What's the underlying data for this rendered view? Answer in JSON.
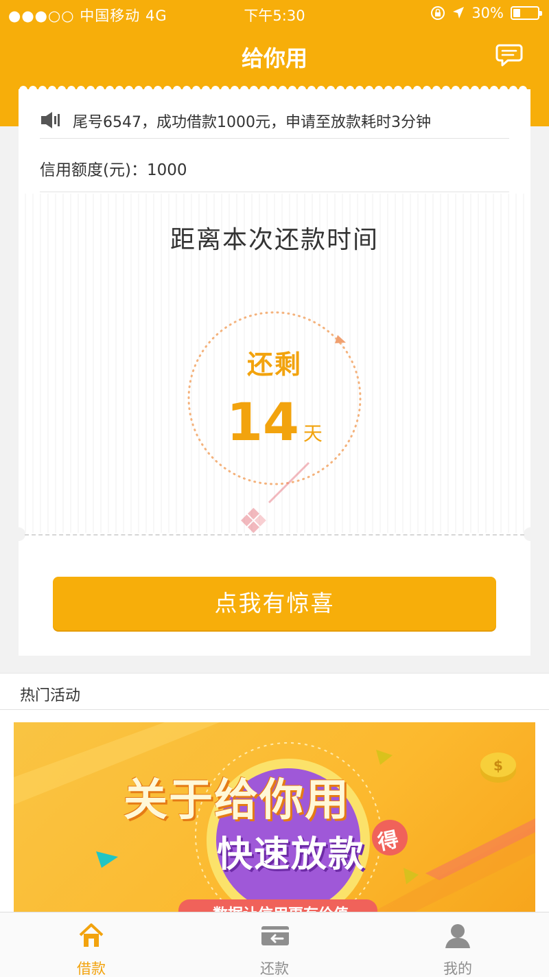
{
  "status_bar": {
    "carrier": "●●●○○ 中国移动   4G",
    "time": "下午5:30",
    "battery": "30%",
    "battery_level": 0.3
  },
  "header": {
    "title": "给你用",
    "message_icon": "chat-bubble-icon"
  },
  "notice": {
    "icon": "speaker-icon",
    "text": "尾号6547，成功借款1000元，申请至放款耗时3分钟"
  },
  "credit": {
    "label": "信用额度(元)：1000"
  },
  "countdown": {
    "title": "距离本次还款时间",
    "remain_label": "还剩",
    "days": "14",
    "unit": "天"
  },
  "cta": {
    "label": "点我有惊喜"
  },
  "activities": {
    "title": "热门活动",
    "banner": {
      "line1": "关于给你用",
      "line2": "快速放款",
      "badge": "得",
      "bottom_text": "数据让信用更有价值"
    }
  },
  "colors": {
    "brand": "#f7ae0a",
    "accent_text": "#f2a30e",
    "tab_inactive": "#8e8e8e"
  },
  "tabs": [
    {
      "label": "借款",
      "icon": "home-icon",
      "active": true
    },
    {
      "label": "还款",
      "icon": "wallet-icon",
      "active": false
    },
    {
      "label": "我的",
      "icon": "user-icon",
      "active": false
    }
  ]
}
